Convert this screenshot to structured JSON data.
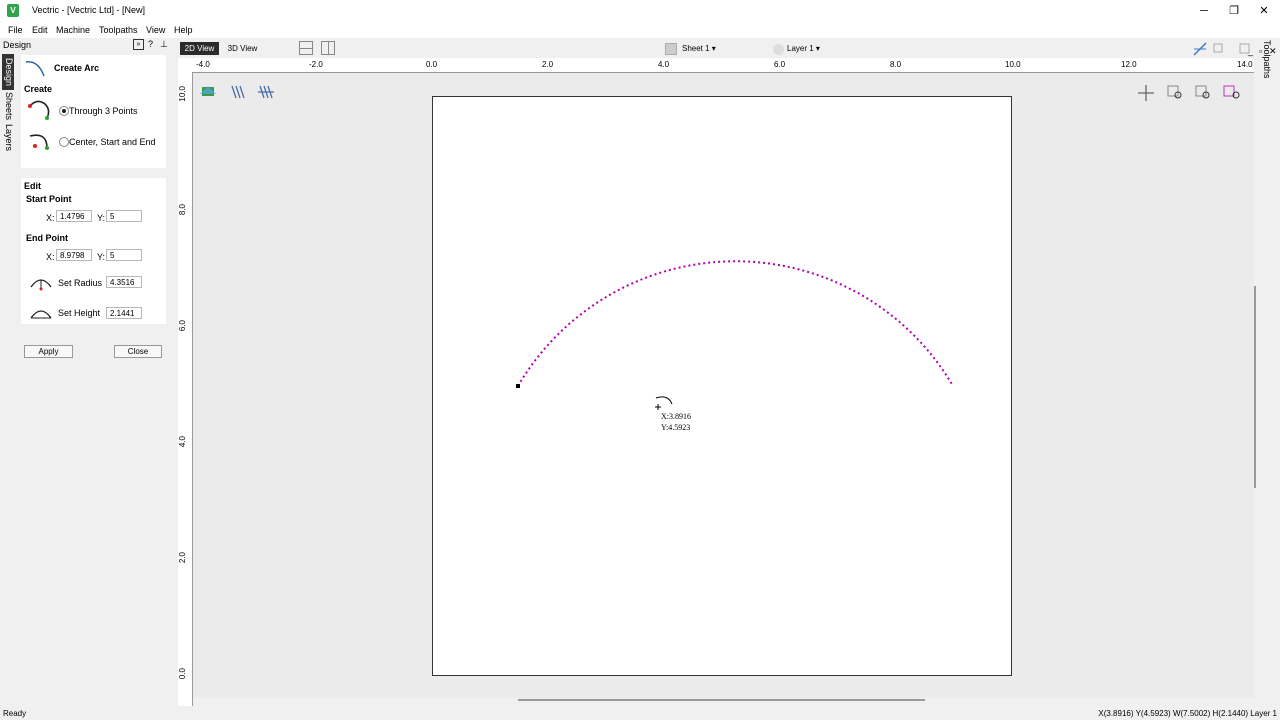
{
  "window": {
    "title": "Vectric - [Vectric Ltd] - [New]",
    "minimize": "─",
    "restore": "❐",
    "close": "✕"
  },
  "menu": [
    "File",
    "Edit",
    "Machine",
    "Toolpaths",
    "View",
    "Help"
  ],
  "mdi_controls": {
    "minimize": "_",
    "restore": "▫",
    "close": "✕"
  },
  "panel": {
    "title": "Design",
    "help": "?",
    "pin": "⊥",
    "tabs": [
      "Design",
      "Sheets",
      "Layers"
    ],
    "tool_name": "Create Arc",
    "create_heading": "Create",
    "options": [
      {
        "label": "Through 3 Points",
        "selected": true
      },
      {
        "label": "Center, Start and End",
        "selected": false
      }
    ],
    "edit_heading": "Edit",
    "start_point_label": "Start Point",
    "start": {
      "x_label": "X:",
      "x": "1.4796",
      "y_label": "Y:",
      "y": "5"
    },
    "end_point_label": "End Point",
    "end": {
      "x_label": "X:",
      "x": "8.9798",
      "y_label": "Y:",
      "y": "5"
    },
    "radius": {
      "label": "Set Radius",
      "value": "4.3516"
    },
    "height": {
      "label": "Set Height",
      "value": "2.1441"
    },
    "apply_label": "Apply",
    "close_label": "Close"
  },
  "view": {
    "tab_2d": "2D View",
    "tab_3d": "3D View",
    "sheet_label": "Sheet 1",
    "layer_label": "Layer 1",
    "right_tab": "Toolpaths"
  },
  "ruler": {
    "x_ticks": [
      "-4.0",
      "-2.0",
      "0.0",
      "2.0",
      "4.0",
      "6.0",
      "8.0",
      "10.0",
      "12.0",
      "14.0"
    ],
    "y_ticks": [
      "10.0",
      "8.0",
      "6.0",
      "4.0",
      "2.0",
      "0.0"
    ]
  },
  "cursor_readout": {
    "x": "X:3.8916",
    "y": "Y:4.5923"
  },
  "arc_color": "#b000b0",
  "accent_color": "#2fa44f",
  "status": {
    "left": "Ready",
    "right": "X(3.8916) Y(4.5923)   W(7.5002) H(2.1440) Layer 1"
  }
}
